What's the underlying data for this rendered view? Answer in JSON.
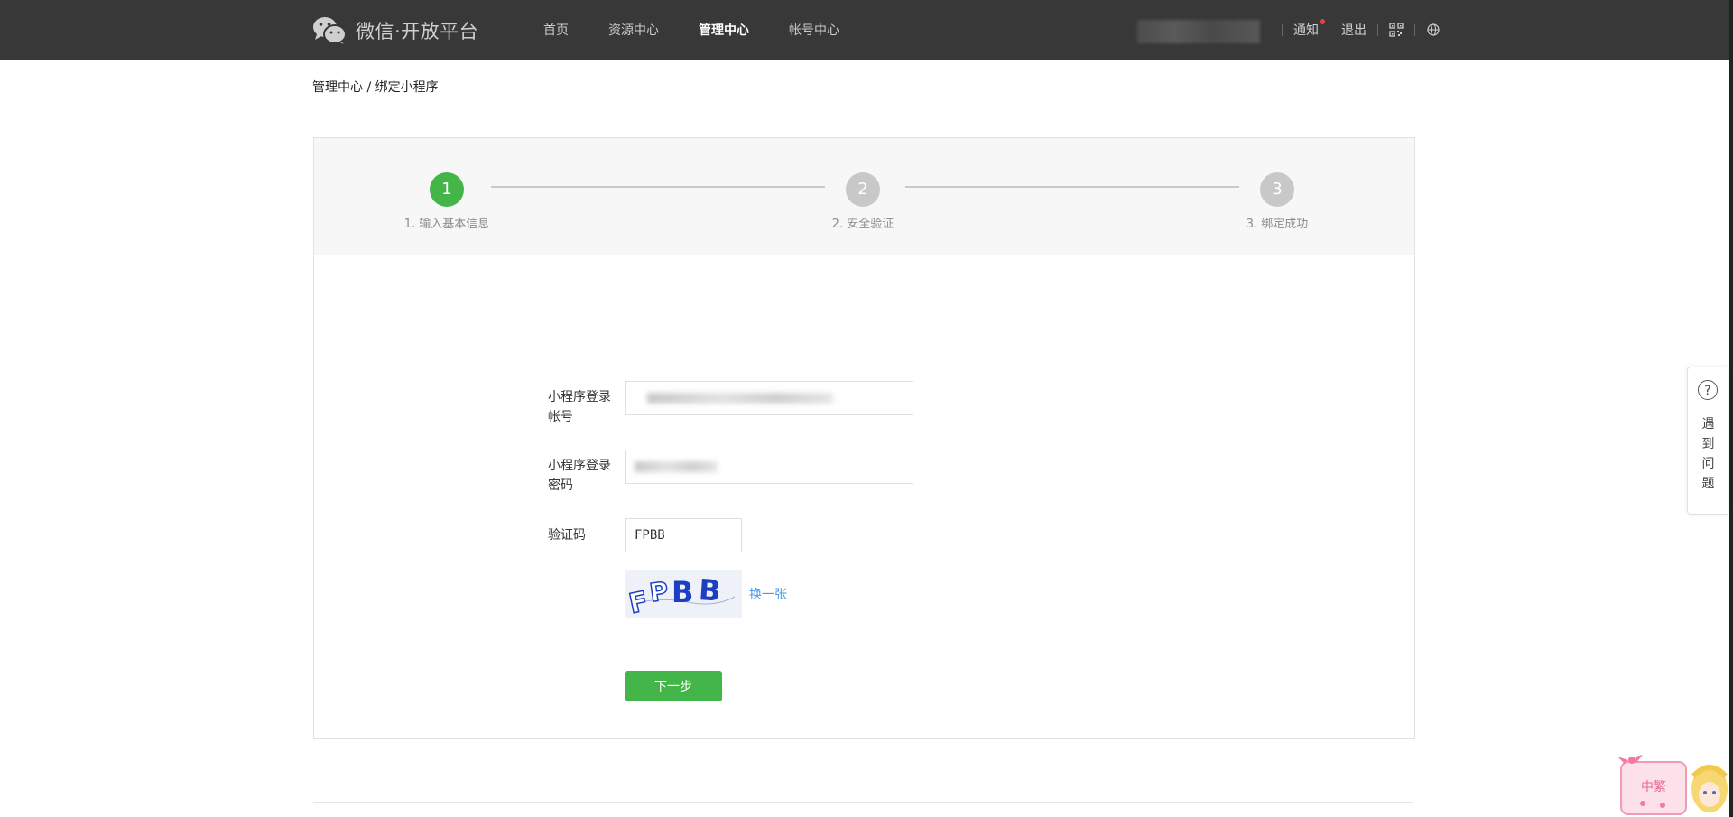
{
  "header": {
    "logo_text": "微信·开放平台",
    "nav": [
      {
        "label": "首页",
        "active": false
      },
      {
        "label": "资源中心",
        "active": false
      },
      {
        "label": "管理中心",
        "active": true
      },
      {
        "label": "帐号中心",
        "active": false
      }
    ],
    "notice_label": "通知",
    "logout_label": "退出",
    "icons": [
      "qrcode-icon",
      "globe-icon"
    ]
  },
  "breadcrumb": "管理中心 / 绑定小程序",
  "steps": [
    {
      "number": "1",
      "label": "1. 输入基本信息",
      "active": true
    },
    {
      "number": "2",
      "label": "2. 安全验证",
      "active": false
    },
    {
      "number": "3",
      "label": "3. 绑定成功",
      "active": false
    }
  ],
  "form": {
    "account_label": "小程序登录帐号",
    "password_label": "小程序登录密码",
    "captcha_label": "验证码",
    "captcha_value": "FPBB",
    "captcha_image_text": "FPBB",
    "refresh_label": "换一张",
    "next_label": "下一步"
  },
  "help": {
    "icon": "?",
    "text": "遇到问题"
  },
  "mascot_text": "中繁",
  "colors": {
    "topbar": "#383838",
    "primary_green": "#44b549",
    "link_blue": "#459ae9",
    "inactive_step": "#c8c8c8"
  }
}
